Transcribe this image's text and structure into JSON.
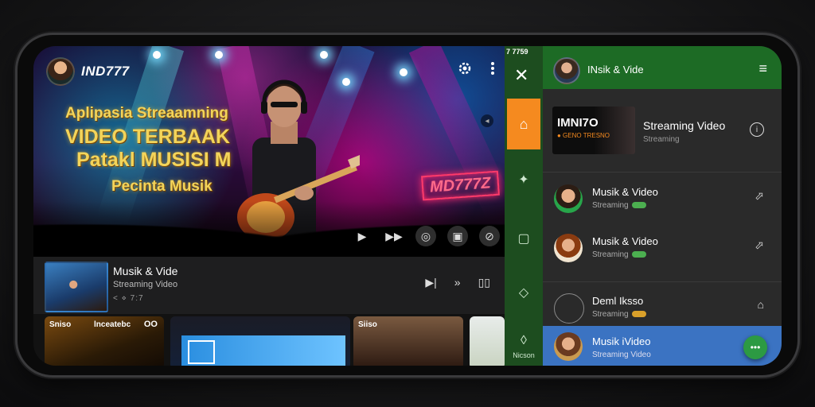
{
  "app": {
    "name": "IND777"
  },
  "hero": {
    "line1": "Aplipasia Streaamning",
    "line2": "VIDEO TERBAAK",
    "line3": "Patakl MUSISI M",
    "line4": "Pecinta Musik",
    "neon_sign": "MD777Z"
  },
  "status": {
    "time": "7 7759"
  },
  "now_playing": {
    "title": "Musik & Vide",
    "subtitle": "Streaming Video",
    "time": "< ⋄ 7:7"
  },
  "cards": [
    {
      "label": "Sniso",
      "label2": "lnceatebc",
      "extra": "OO"
    },
    {
      "label": ""
    },
    {
      "label": "Siiso"
    },
    {
      "label": ""
    }
  ],
  "rail": {
    "bottom_label": "Nicson"
  },
  "panel": {
    "header_title": "INsik & Vide",
    "featured": {
      "thumb_title": "IMNI7O",
      "thumb_sub": "● GENO TRESNO",
      "title": "Streaming Video",
      "subtitle": "Streaming"
    },
    "items": [
      {
        "title": "Musik & Video",
        "subtitle": "Streaming"
      },
      {
        "title": "Musik & Video",
        "subtitle": "Streaming"
      },
      {
        "title": "Deml Iksso",
        "subtitle": "Streaming"
      },
      {
        "title": "Musik iVideo",
        "subtitle": "Streaming Video"
      }
    ]
  },
  "colors": {
    "accent_green": "#1d6b25",
    "accent_orange": "#f58a1f",
    "highlight_blue": "#3b73c2"
  }
}
